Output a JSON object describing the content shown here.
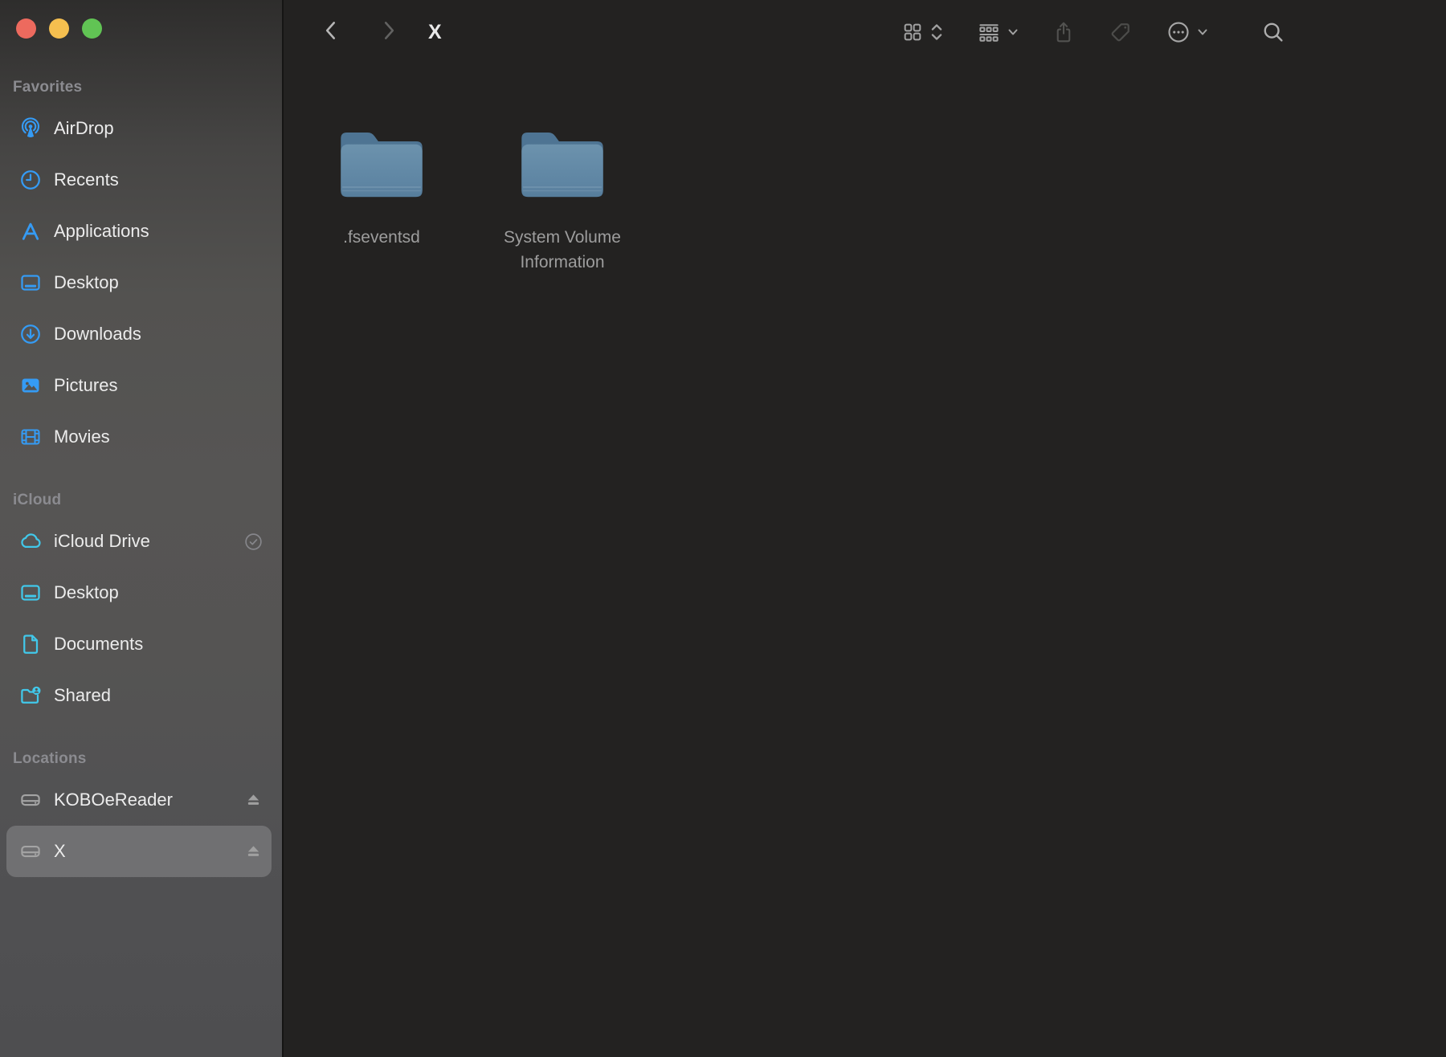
{
  "window": {
    "title": "X"
  },
  "traffic_lights": {
    "close_color": "#ED6A5E",
    "minimize_color": "#F5BF4F",
    "zoom_color": "#61C454"
  },
  "toolbar": {
    "title": "X",
    "back_enabled": true,
    "forward_enabled": false,
    "icons": [
      "back-chevron",
      "forward-chevron",
      "view-grid",
      "view-stepper",
      "group-by",
      "share",
      "tag",
      "more-ellipsis",
      "more-chevron",
      "search"
    ]
  },
  "sidebar": {
    "sections": [
      {
        "label": "Favorites",
        "tint": "#359BF4",
        "items": [
          {
            "label": "AirDrop",
            "icon": "airdrop"
          },
          {
            "label": "Recents",
            "icon": "clock"
          },
          {
            "label": "Applications",
            "icon": "app-store"
          },
          {
            "label": "Desktop",
            "icon": "desktop"
          },
          {
            "label": "Downloads",
            "icon": "downloads"
          },
          {
            "label": "Pictures",
            "icon": "pictures"
          },
          {
            "label": "Movies",
            "icon": "movies"
          }
        ]
      },
      {
        "label": "iCloud",
        "tint": "#41C8EA",
        "items": [
          {
            "label": "iCloud Drive",
            "icon": "icloud",
            "trailing": "check-circle"
          },
          {
            "label": "Desktop",
            "icon": "desktop"
          },
          {
            "label": "Documents",
            "icon": "document"
          },
          {
            "label": "Shared",
            "icon": "shared-folder"
          }
        ]
      },
      {
        "label": "Locations",
        "tint": "#A4A4A4",
        "items": [
          {
            "label": "KOBOeReader",
            "icon": "drive",
            "eject": true
          },
          {
            "label": "X",
            "icon": "drive",
            "eject": true,
            "selected": true
          }
        ]
      }
    ]
  },
  "content": {
    "items": [
      {
        "name": ".fseventsd",
        "type": "folder",
        "hidden": true
      },
      {
        "name": "System Volume Information",
        "type": "folder",
        "hidden": true
      }
    ]
  },
  "colors": {
    "content_bg": "#232221",
    "sidebar_selection": "rgba(255,255,255,0.18)",
    "folder_blue_top": "#4E7493",
    "folder_blue_body": "#6B91AC",
    "folder_label": "#9D9D9D",
    "toolbar_icon_active": "#A2A2A2",
    "toolbar_icon_disabled": "#4F4F4D",
    "section_header": "#8B8B90"
  }
}
